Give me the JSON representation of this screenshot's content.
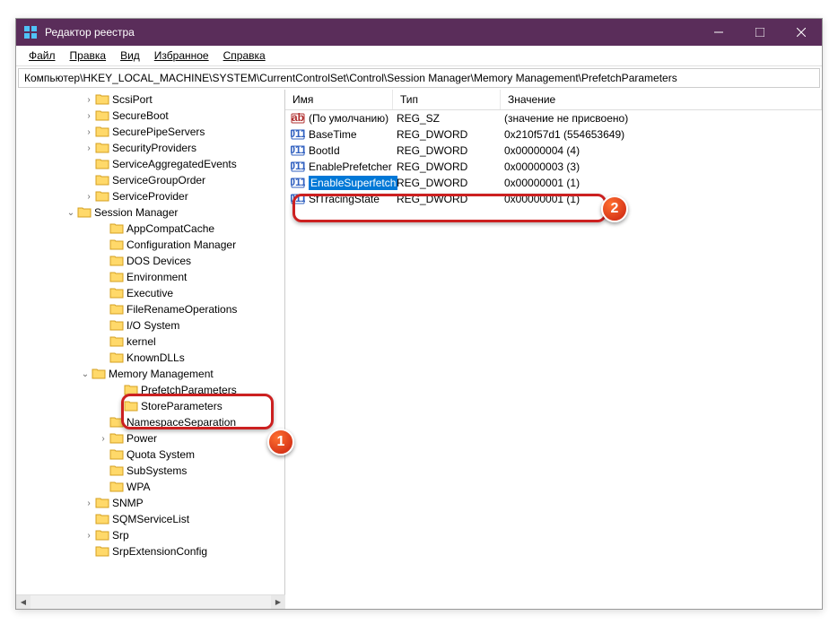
{
  "window": {
    "title": "Редактор реестра"
  },
  "menu": {
    "file": "Файл",
    "edit": "Правка",
    "view": "Вид",
    "favorites": "Избранное",
    "help": "Справка"
  },
  "address": "Компьютер\\HKEY_LOCAL_MACHINE\\SYSTEM\\CurrentControlSet\\Control\\Session Manager\\Memory Management\\PrefetchParameters",
  "columns": {
    "name": "Имя",
    "type": "Тип",
    "value": "Значение"
  },
  "tree": [
    "ScsiPort",
    "SecureBoot",
    "SecurePipeServers",
    "SecurityProviders",
    "ServiceAggregatedEvents",
    "ServiceGroupOrder",
    "ServiceProvider"
  ],
  "session_manager": {
    "label": "Session Manager",
    "children": [
      "AppCompatCache",
      "Configuration Manager",
      "DOS Devices",
      "Environment",
      "Executive",
      "FileRenameOperations",
      "I/O System",
      "kernel",
      "KnownDLLs"
    ],
    "memory": {
      "label": "Memory Management",
      "children": [
        "PrefetchParameters",
        "StoreParameters"
      ]
    },
    "after": [
      "NamespaceSeparation",
      "Power",
      "Quota System",
      "SubSystems",
      "WPA"
    ]
  },
  "tree_after": [
    "SNMP",
    "SQMServiceList",
    "Srp",
    "SrpExtensionConfig"
  ],
  "values": [
    {
      "name": "(По умолчанию)",
      "type": "REG_SZ",
      "data": "(значение не присвоено)",
      "icon": "sz"
    },
    {
      "name": "BaseTime",
      "type": "REG_DWORD",
      "data": "0x210f57d1 (554653649)",
      "icon": "dw"
    },
    {
      "name": "BootId",
      "type": "REG_DWORD",
      "data": "0x00000004 (4)",
      "icon": "dw"
    },
    {
      "name": "EnablePrefetcher",
      "type": "REG_DWORD",
      "data": "0x00000003 (3)",
      "icon": "dw"
    },
    {
      "name": "EnableSuperfetch",
      "type": "REG_DWORD",
      "data": "0x00000001 (1)",
      "icon": "dw",
      "selected": true
    },
    {
      "name": "SfTracingState",
      "type": "REG_DWORD",
      "data": "0x00000001 (1)",
      "icon": "dw"
    }
  ],
  "badges": {
    "b1": "1",
    "b2": "2"
  }
}
